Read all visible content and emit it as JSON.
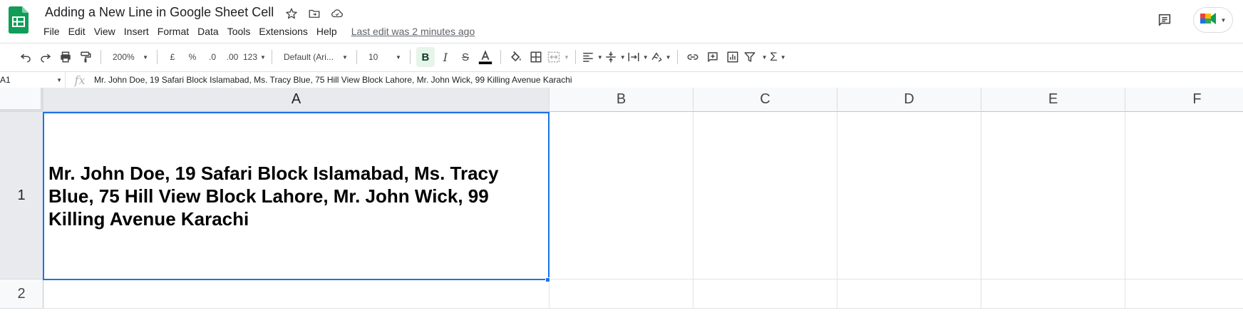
{
  "doc": {
    "title": "Adding a New Line in Google Sheet Cell",
    "last_edit": "Last edit was 2 minutes ago"
  },
  "menu": [
    "File",
    "Edit",
    "View",
    "Insert",
    "Format",
    "Data",
    "Tools",
    "Extensions",
    "Help"
  ],
  "toolbar": {
    "zoom": "200%",
    "currency": "£",
    "percent": "%",
    "decrease_decimals": ".0",
    "increase_decimals": ".00",
    "more_formats": "123",
    "font": "Default (Ari...",
    "font_size": "10",
    "bold_active": true
  },
  "formula_bar": {
    "name_box": "A1",
    "fx_label": "fx",
    "content": "Mr. John Doe, 19 Safari Block Islamabad, Ms. Tracy Blue, 75 Hill View Block Lahore, Mr. John Wick, 99 Killing Avenue Karachi"
  },
  "grid": {
    "columns": [
      "A",
      "B",
      "C",
      "D",
      "E",
      "F"
    ],
    "rows": [
      "1",
      "2"
    ],
    "selected_column": "A",
    "selected_row": "1",
    "cell_a1": "Mr. John Doe, 19 Safari Block Islamabad, Ms. Tracy Blue, 75 Hill View Block Lahore, Mr. John Wick, 99 Killing Avenue Karachi"
  },
  "colors": {
    "sheets_green": "#0f9d58",
    "selection_blue": "#1a73e8",
    "header_bg": "#f8f9fa",
    "selected_header_bg": "#e8eaed"
  }
}
